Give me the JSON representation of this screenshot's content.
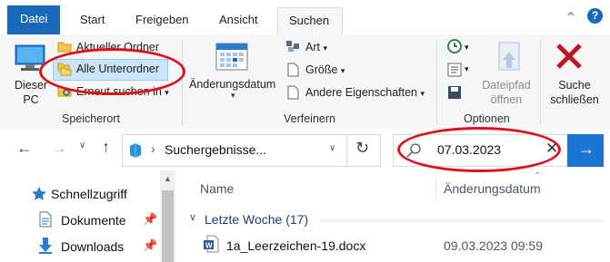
{
  "tabs": [
    "Datei",
    "Start",
    "Freigeben",
    "Ansicht",
    "Suchen"
  ],
  "ribbon": {
    "location": {
      "this_pc": [
        "Dieser",
        "PC"
      ],
      "current_folder": "Aktueller Ordner",
      "all_subfolders": "Alle Unterordner",
      "search_again": "Erneut suchen in",
      "group_label": "Speicherort"
    },
    "refine": {
      "modified_date": "Änderungsdatum",
      "kind": "Art",
      "size": "Größe",
      "other_props": "Andere Eigenschaften",
      "group_label": "Verfeinern"
    },
    "options": {
      "file_path": [
        "Dateipfad",
        "öffnen"
      ],
      "group_label": "Optionen"
    },
    "close_search": [
      "Suche",
      "schließen"
    ]
  },
  "address": {
    "path": "Suchergebnisse...",
    "search_value": "07.03.2023"
  },
  "nav_pane": [
    {
      "label": "Schnellzugriff",
      "icon": "star-icon"
    },
    {
      "label": "Dokumente",
      "icon": "documents-icon",
      "pinned": true
    },
    {
      "label": "Downloads",
      "icon": "download-arrow-icon",
      "pinned": true
    }
  ],
  "columns": {
    "name": "Name",
    "date": "Änderungsdatum"
  },
  "group": {
    "label": "Letzte Woche (17)"
  },
  "files": [
    {
      "name": "1a_Leerzeichen-19.docx",
      "date": "09.03.2023 09:59"
    }
  ],
  "colors": {
    "accent": "#1a68b8",
    "highlight": "#e0101a",
    "go": "#1976d2"
  }
}
